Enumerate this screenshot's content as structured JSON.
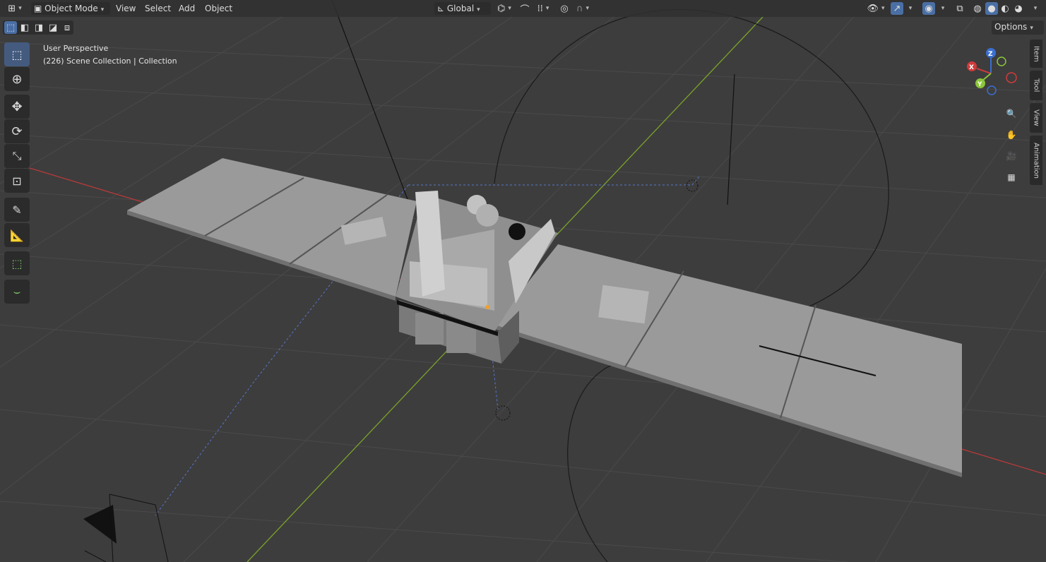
{
  "header": {
    "editor_type_icon": "3d-viewport-icon",
    "mode": "Object Mode",
    "menus": [
      "View",
      "Select",
      "Add",
      "Object"
    ],
    "orientation": "Global",
    "options": "Options"
  },
  "viewport_info": {
    "perspective": "User Perspective",
    "collection": "(226) Scene Collection | Collection"
  },
  "side_tabs": [
    "Item",
    "Tool",
    "View",
    "Animation"
  ],
  "gizmo_axes": {
    "x": "X",
    "y": "Y",
    "z": "Z"
  },
  "colors": {
    "viewport_bg": "#3d3d3d",
    "x_axis": "#b83a3a",
    "y_axis": "#7aa329",
    "active_tool": "#445b7f",
    "selection_dash": "#5577cc"
  },
  "tools": [
    "select-box",
    "cursor",
    "move",
    "rotate",
    "scale",
    "transform",
    "annotate",
    "measure",
    "add-cube",
    "edit-curve"
  ]
}
